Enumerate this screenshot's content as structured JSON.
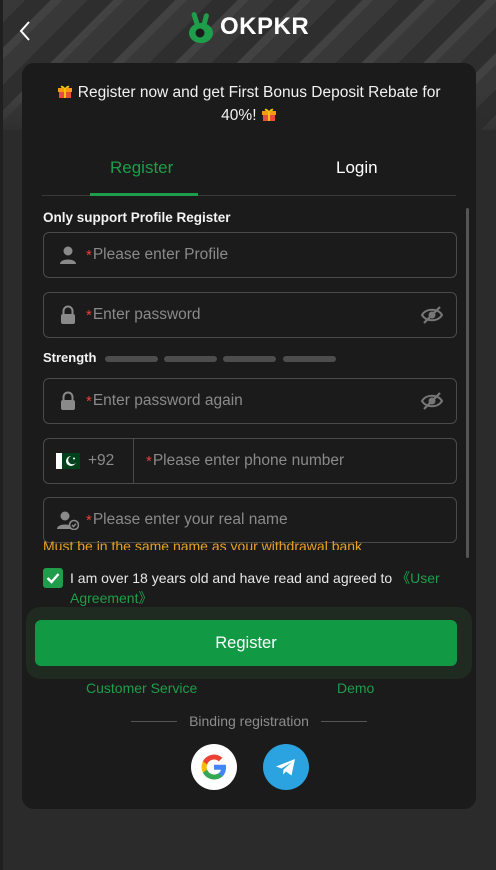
{
  "brand": {
    "name": "OKPKR",
    "color": "#1e9e4a"
  },
  "colors": {
    "accent": "#1e9e4a",
    "button": "#119944",
    "required": "#e0433c",
    "warning": "#e9a125",
    "card": "#1b1b1b"
  },
  "icons": [
    "chevron-left-icon",
    "logo-hand-icon",
    "gift-icon",
    "user-icon",
    "lock-icon",
    "eye-off-icon",
    "pakistan-flag-icon",
    "user-check-icon",
    "check-icon",
    "google-icon",
    "telegram-icon"
  ],
  "promo": {
    "text": "Register now and get First Bonus Deposit Rebate for 40%!"
  },
  "tabs": [
    {
      "label": "Register",
      "active": true
    },
    {
      "label": "Login",
      "active": false
    }
  ],
  "form": {
    "support_label": "Only support Profile Register",
    "required_mark": "*",
    "profile_placeholder": "Please enter Profile",
    "password_placeholder": "Enter password",
    "strength_label": "Strength",
    "password_again_placeholder": "Enter password again",
    "country_code": "+92",
    "phone_placeholder": "Please enter phone number",
    "realname_placeholder": "Please enter your real name",
    "warning": "Must be in the same name as your withdrawal bank"
  },
  "agreement": {
    "checked": true,
    "text": "I am over 18 years old and have read and agreed to ",
    "link": "《User Agreement》"
  },
  "register_button": "Register",
  "links": {
    "customer_service": "Customer Service",
    "demo": "Demo"
  },
  "binding": {
    "label": "Binding registration"
  }
}
